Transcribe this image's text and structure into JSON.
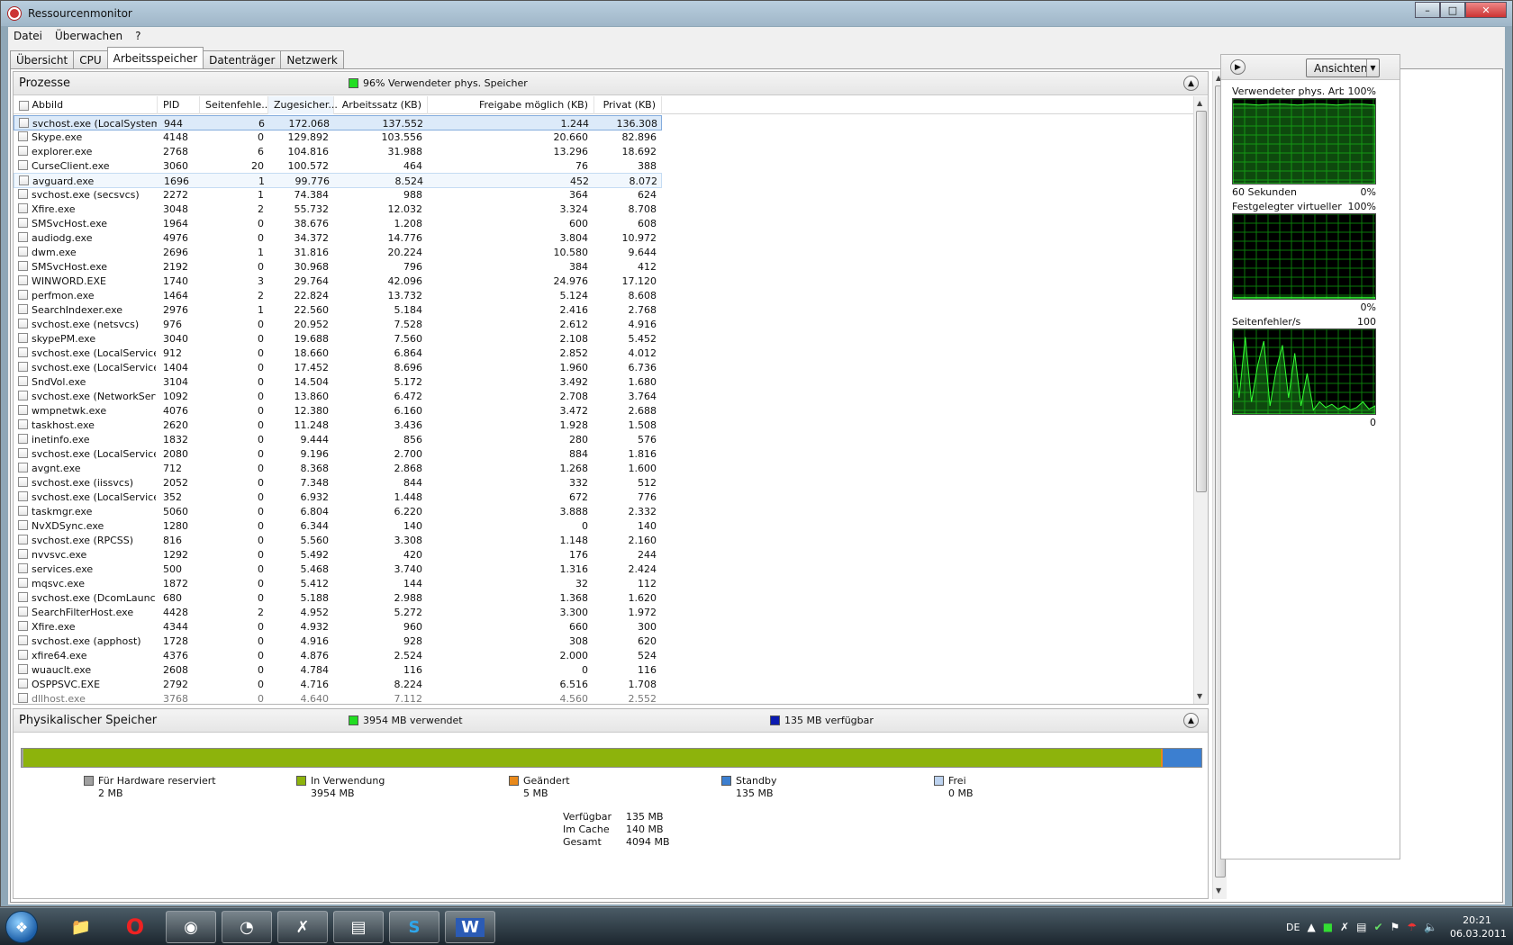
{
  "window": {
    "title": "Ressourcenmonitor"
  },
  "menu": [
    "Datei",
    "Überwachen",
    "?"
  ],
  "tabs": [
    "Übersicht",
    "CPU",
    "Arbeitsspeicher",
    "Datenträger",
    "Netzwerk"
  ],
  "processes": {
    "title": "Prozesse",
    "legend": "96% Verwendeter phys. Speicher",
    "legend_color": "#22dd22",
    "columns": [
      "Abbild",
      "PID",
      "Seitenfehle...",
      "Zugesicher...",
      "Arbeitssatz (KB)",
      "Freigabe möglich (KB)",
      "Privat (KB)"
    ],
    "rows": [
      [
        "svchost.exe (LocalSystemN...",
        "944",
        "6",
        "172.068",
        "137.552",
        "1.244",
        "136.308"
      ],
      [
        "Skype.exe",
        "4148",
        "0",
        "129.892",
        "103.556",
        "20.660",
        "82.896"
      ],
      [
        "explorer.exe",
        "2768",
        "6",
        "104.816",
        "31.988",
        "13.296",
        "18.692"
      ],
      [
        "CurseClient.exe",
        "3060",
        "20",
        "100.572",
        "464",
        "76",
        "388"
      ],
      [
        "avguard.exe",
        "1696",
        "1",
        "99.776",
        "8.524",
        "452",
        "8.072"
      ],
      [
        "svchost.exe (secsvcs)",
        "2272",
        "1",
        "74.384",
        "988",
        "364",
        "624"
      ],
      [
        "Xfire.exe",
        "3048",
        "2",
        "55.732",
        "12.032",
        "3.324",
        "8.708"
      ],
      [
        "SMSvcHost.exe",
        "1964",
        "0",
        "38.676",
        "1.208",
        "600",
        "608"
      ],
      [
        "audiodg.exe",
        "4976",
        "0",
        "34.372",
        "14.776",
        "3.804",
        "10.972"
      ],
      [
        "dwm.exe",
        "2696",
        "1",
        "31.816",
        "20.224",
        "10.580",
        "9.644"
      ],
      [
        "SMSvcHost.exe",
        "2192",
        "0",
        "30.968",
        "796",
        "384",
        "412"
      ],
      [
        "WINWORD.EXE",
        "1740",
        "3",
        "29.764",
        "42.096",
        "24.976",
        "17.120"
      ],
      [
        "perfmon.exe",
        "1464",
        "2",
        "22.824",
        "13.732",
        "5.124",
        "8.608"
      ],
      [
        "SearchIndexer.exe",
        "2976",
        "1",
        "22.560",
        "5.184",
        "2.416",
        "2.768"
      ],
      [
        "svchost.exe (netsvcs)",
        "976",
        "0",
        "20.952",
        "7.528",
        "2.612",
        "4.916"
      ],
      [
        "skypePM.exe",
        "3040",
        "0",
        "19.688",
        "7.560",
        "2.108",
        "5.452"
      ],
      [
        "svchost.exe (LocalServiceN...",
        "912",
        "0",
        "18.660",
        "6.864",
        "2.852",
        "4.012"
      ],
      [
        "svchost.exe (LocalServiceN...",
        "1404",
        "0",
        "17.452",
        "8.696",
        "1.960",
        "6.736"
      ],
      [
        "SndVol.exe",
        "3104",
        "0",
        "14.504",
        "5.172",
        "3.492",
        "1.680"
      ],
      [
        "svchost.exe (NetworkServi...",
        "1092",
        "0",
        "13.860",
        "6.472",
        "2.708",
        "3.764"
      ],
      [
        "wmpnetwk.exe",
        "4076",
        "0",
        "12.380",
        "6.160",
        "3.472",
        "2.688"
      ],
      [
        "taskhost.exe",
        "2620",
        "0",
        "11.248",
        "3.436",
        "1.928",
        "1.508"
      ],
      [
        "inetinfo.exe",
        "1832",
        "0",
        "9.444",
        "856",
        "280",
        "576"
      ],
      [
        "svchost.exe (LocalServiceA...",
        "2080",
        "0",
        "9.196",
        "2.700",
        "884",
        "1.816"
      ],
      [
        "avgnt.exe",
        "712",
        "0",
        "8.368",
        "2.868",
        "1.268",
        "1.600"
      ],
      [
        "svchost.exe (iissvcs)",
        "2052",
        "0",
        "7.348",
        "844",
        "332",
        "512"
      ],
      [
        "svchost.exe (LocalService)",
        "352",
        "0",
        "6.932",
        "1.448",
        "672",
        "776"
      ],
      [
        "taskmgr.exe",
        "5060",
        "0",
        "6.804",
        "6.220",
        "3.888",
        "2.332"
      ],
      [
        "NvXDSync.exe",
        "1280",
        "0",
        "6.344",
        "140",
        "0",
        "140"
      ],
      [
        "svchost.exe (RPCSS)",
        "816",
        "0",
        "5.560",
        "3.308",
        "1.148",
        "2.160"
      ],
      [
        "nvvsvc.exe",
        "1292",
        "0",
        "5.492",
        "420",
        "176",
        "244"
      ],
      [
        "services.exe",
        "500",
        "0",
        "5.468",
        "3.740",
        "1.316",
        "2.424"
      ],
      [
        "mqsvc.exe",
        "1872",
        "0",
        "5.412",
        "144",
        "32",
        "112"
      ],
      [
        "svchost.exe (DcomLaunch)",
        "680",
        "0",
        "5.188",
        "2.988",
        "1.368",
        "1.620"
      ],
      [
        "SearchFilterHost.exe",
        "4428",
        "2",
        "4.952",
        "5.272",
        "3.300",
        "1.972"
      ],
      [
        "Xfire.exe",
        "4344",
        "0",
        "4.932",
        "960",
        "660",
        "300"
      ],
      [
        "svchost.exe (apphost)",
        "1728",
        "0",
        "4.916",
        "928",
        "308",
        "620"
      ],
      [
        "xfire64.exe",
        "4376",
        "0",
        "4.876",
        "2.524",
        "2.000",
        "524"
      ],
      [
        "wuauclt.exe",
        "2608",
        "0",
        "4.784",
        "116",
        "0",
        "116"
      ],
      [
        "OSPPSVC.EXE",
        "2792",
        "0",
        "4.716",
        "8.224",
        "6.516",
        "1.708"
      ],
      [
        "dllhost.exe",
        "3768",
        "0",
        "4.640",
        "7.112",
        "4.560",
        "2.552"
      ]
    ]
  },
  "physical": {
    "title": "Physikalischer Speicher",
    "legend_used": "3954 MB verwendet",
    "legend_avail": "135 MB verfügbar",
    "used_color": "#22dd22",
    "avail_color": "#0b1bb0",
    "bar": [
      {
        "name": "hardware",
        "mb": 2,
        "color": "#a0a0a0"
      },
      {
        "name": "inuse",
        "mb": 3954,
        "color": "#8db30c"
      },
      {
        "name": "modified",
        "mb": 5,
        "color": "#e8891b"
      },
      {
        "name": "standby",
        "mb": 135,
        "color": "#3c7fd0"
      },
      {
        "name": "free",
        "mb": 0,
        "color": "#bcd2ef"
      }
    ],
    "legend": [
      {
        "label": "Für Hardware reserviert",
        "value": "2 MB",
        "color": "#a0a0a0"
      },
      {
        "label": "In Verwendung",
        "value": "3954 MB",
        "color": "#8db30c"
      },
      {
        "label": "Geändert",
        "value": "5 MB",
        "color": "#e8891b"
      },
      {
        "label": "Standby",
        "value": "135 MB",
        "color": "#3c7fd0"
      },
      {
        "label": "Frei",
        "value": "0 MB",
        "color": "#bcd2ef"
      }
    ],
    "summary": [
      {
        "k": "Verfügbar",
        "v": "135 MB"
      },
      {
        "k": "Im Cache",
        "v": "140 MB"
      },
      {
        "k": "Gesamt",
        "v": "4094 MB"
      }
    ]
  },
  "side": {
    "views_button": "Ansichten",
    "graphs": [
      {
        "title": "Verwendeter phys. Arbe...",
        "max": "100%",
        "bl": "60 Sekunden",
        "br": "0%",
        "levels": [
          0.98,
          0.98,
          0.97,
          0.98,
          0.98,
          0.97,
          0.98,
          0.98,
          0.97,
          0.98,
          0.98,
          0.97
        ]
      },
      {
        "title": "Festgelegter virtueller S...",
        "max": "100%",
        "bl": "",
        "br": "0%",
        "levels": [
          0.02,
          0.02,
          0.02,
          0.02,
          0.02,
          0.02,
          0.02,
          0.02,
          0.02,
          0.02,
          0.02,
          0.02
        ]
      },
      {
        "title": "Seitenfehler/s",
        "max": "100",
        "bl": "",
        "br": "0",
        "levels": [
          0.9,
          0.2,
          0.95,
          0.15,
          0.6,
          0.9,
          0.1,
          0.55,
          0.85,
          0.2,
          0.75,
          0.1,
          0.5,
          0.05,
          0.15,
          0.08,
          0.12,
          0.06,
          0.1,
          0.05,
          0.08,
          0.15,
          0.06,
          0.1
        ]
      }
    ]
  },
  "taskbar": {
    "lang": "DE",
    "time": "20:21",
    "date": "06.03.2011"
  }
}
